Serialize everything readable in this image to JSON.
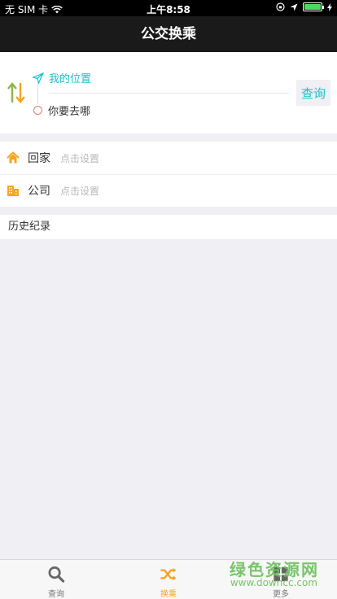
{
  "status": {
    "carrier": "无 SIM 卡",
    "time": "上午8:58"
  },
  "nav": {
    "title": "公交换乘"
  },
  "route": {
    "from": "我的位置",
    "to": "你要去哪",
    "query_label": "查询"
  },
  "shortcuts": {
    "home": {
      "label": "回家",
      "hint": "点击设置"
    },
    "company": {
      "label": "公司",
      "hint": "点击设置"
    }
  },
  "history": {
    "title": "历史纪录"
  },
  "tabs": [
    {
      "label": "查询",
      "icon": "search-icon"
    },
    {
      "label": "换乘",
      "icon": "shuffle-icon"
    },
    {
      "label": "更多",
      "icon": "grid-icon"
    }
  ],
  "watermark": {
    "main": "绿色资源网",
    "sub": "www.downcc.com"
  },
  "colors": {
    "accent": "#19c1c9",
    "orange": "#f5a623",
    "navbar": "#1a1a1a"
  }
}
